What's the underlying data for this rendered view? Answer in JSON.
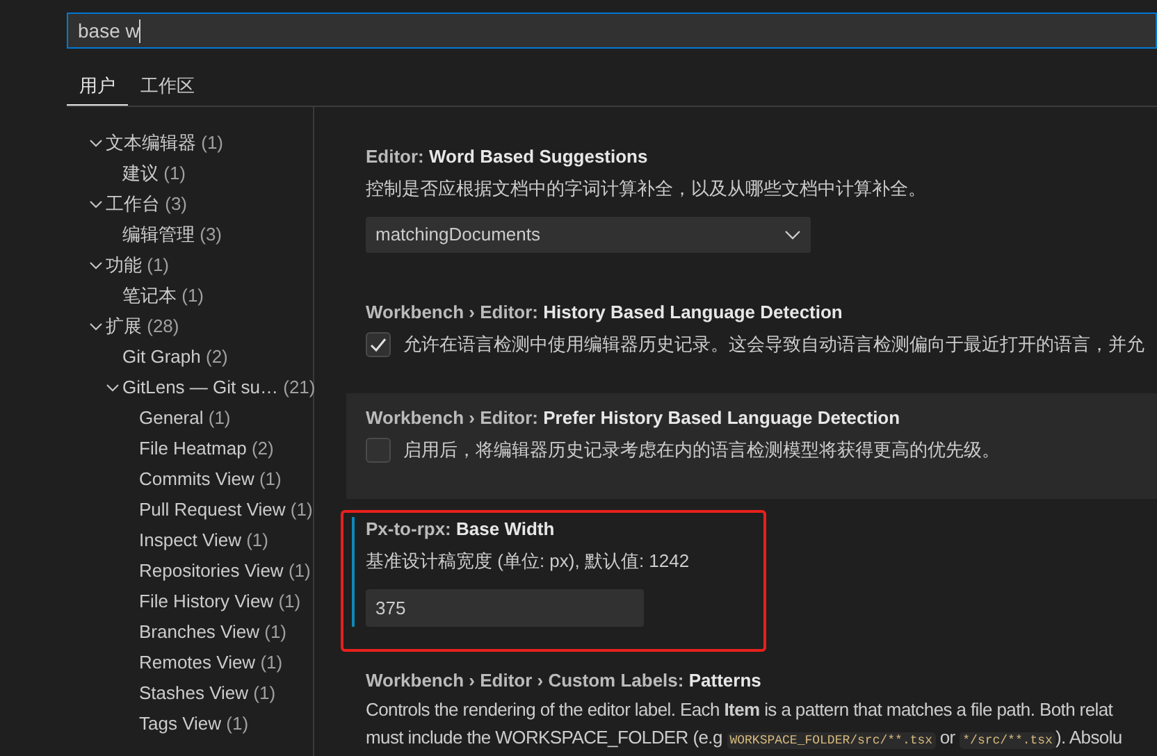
{
  "search": {
    "value": "base w"
  },
  "tabs": [
    {
      "label": "用户",
      "selected": true
    },
    {
      "label": "工作区",
      "selected": false
    }
  ],
  "tree": [
    {
      "label": "文本编辑器",
      "count": "(1)",
      "expanded": true,
      "children": [
        {
          "label": "建议",
          "count": "(1)"
        }
      ]
    },
    {
      "label": "工作台",
      "count": "(3)",
      "expanded": true,
      "children": [
        {
          "label": "编辑管理",
          "count": "(3)"
        }
      ]
    },
    {
      "label": "功能",
      "count": "(1)",
      "expanded": true,
      "children": [
        {
          "label": "笔记本",
          "count": "(1)"
        }
      ]
    },
    {
      "label": "扩展",
      "count": "(28)",
      "expanded": true,
      "children": [
        {
          "label": "Git Graph",
          "count": "(2)"
        },
        {
          "label": "GitLens — Git su…",
          "count": "(21)",
          "expanded": true,
          "children": [
            {
              "label": "General",
              "count": "(1)"
            },
            {
              "label": "File Heatmap",
              "count": "(2)"
            },
            {
              "label": "Commits View",
              "count": "(1)"
            },
            {
              "label": "Pull Request View",
              "count": "(1)"
            },
            {
              "label": "Inspect View",
              "count": "(1)"
            },
            {
              "label": "Repositories View",
              "count": "(1)"
            },
            {
              "label": "File History View",
              "count": "(1)"
            },
            {
              "label": "Branches View",
              "count": "(1)"
            },
            {
              "label": "Remotes View",
              "count": "(1)"
            },
            {
              "label": "Stashes View",
              "count": "(1)"
            },
            {
              "label": "Tags View",
              "count": "(1)"
            }
          ]
        }
      ]
    }
  ],
  "settings": [
    {
      "kind": "select",
      "category": "Editor: ",
      "name": "Word Based Suggestions",
      "description": "控制是否应根据文档中的字词计算补全，以及从哪些文档中计算补全。",
      "value": "matchingDocuments"
    },
    {
      "kind": "checkbox",
      "category": "Workbench › Editor: ",
      "name": "History Based Language Detection",
      "description": "允许在语言检测中使用编辑器历史记录。这会导致自动语言检测偏向于最近打开的语言，并允",
      "checked": true
    },
    {
      "kind": "checkbox",
      "category": "Workbench › Editor: ",
      "name": "Prefer History Based Language Detection",
      "description": "启用后，将编辑器历史记录考虑在内的语言检测模型将获得更高的优先级。",
      "checked": false,
      "hovered": true
    },
    {
      "kind": "number",
      "category": "Px-to-rpx: ",
      "name": "Base Width",
      "description": "基准设计稿宽度 (单位: px), 默认值: 1242",
      "value": "375",
      "focused": true,
      "highlighted": true
    },
    {
      "kind": "text",
      "category": "Workbench › Editor › Custom Labels: ",
      "name": "Patterns",
      "lines": [
        [
          {
            "kind": "text",
            "text": "Controls the rendering of the editor label. Each **Item** is a pattern that matches a file path. Both relat"
          }
        ],
        [
          {
            "kind": "text",
            "text": "must include the WORKSPACE_FOLDER (e.g "
          },
          {
            "kind": "code",
            "text": "WORKSPACE_FOLDER/src/**.tsx"
          },
          {
            "kind": "text",
            "text": " or "
          },
          {
            "kind": "code",
            "text": "*/src/**.tsx"
          },
          {
            "kind": "text",
            "text": "). Absolu"
          }
        ]
      ]
    }
  ]
}
